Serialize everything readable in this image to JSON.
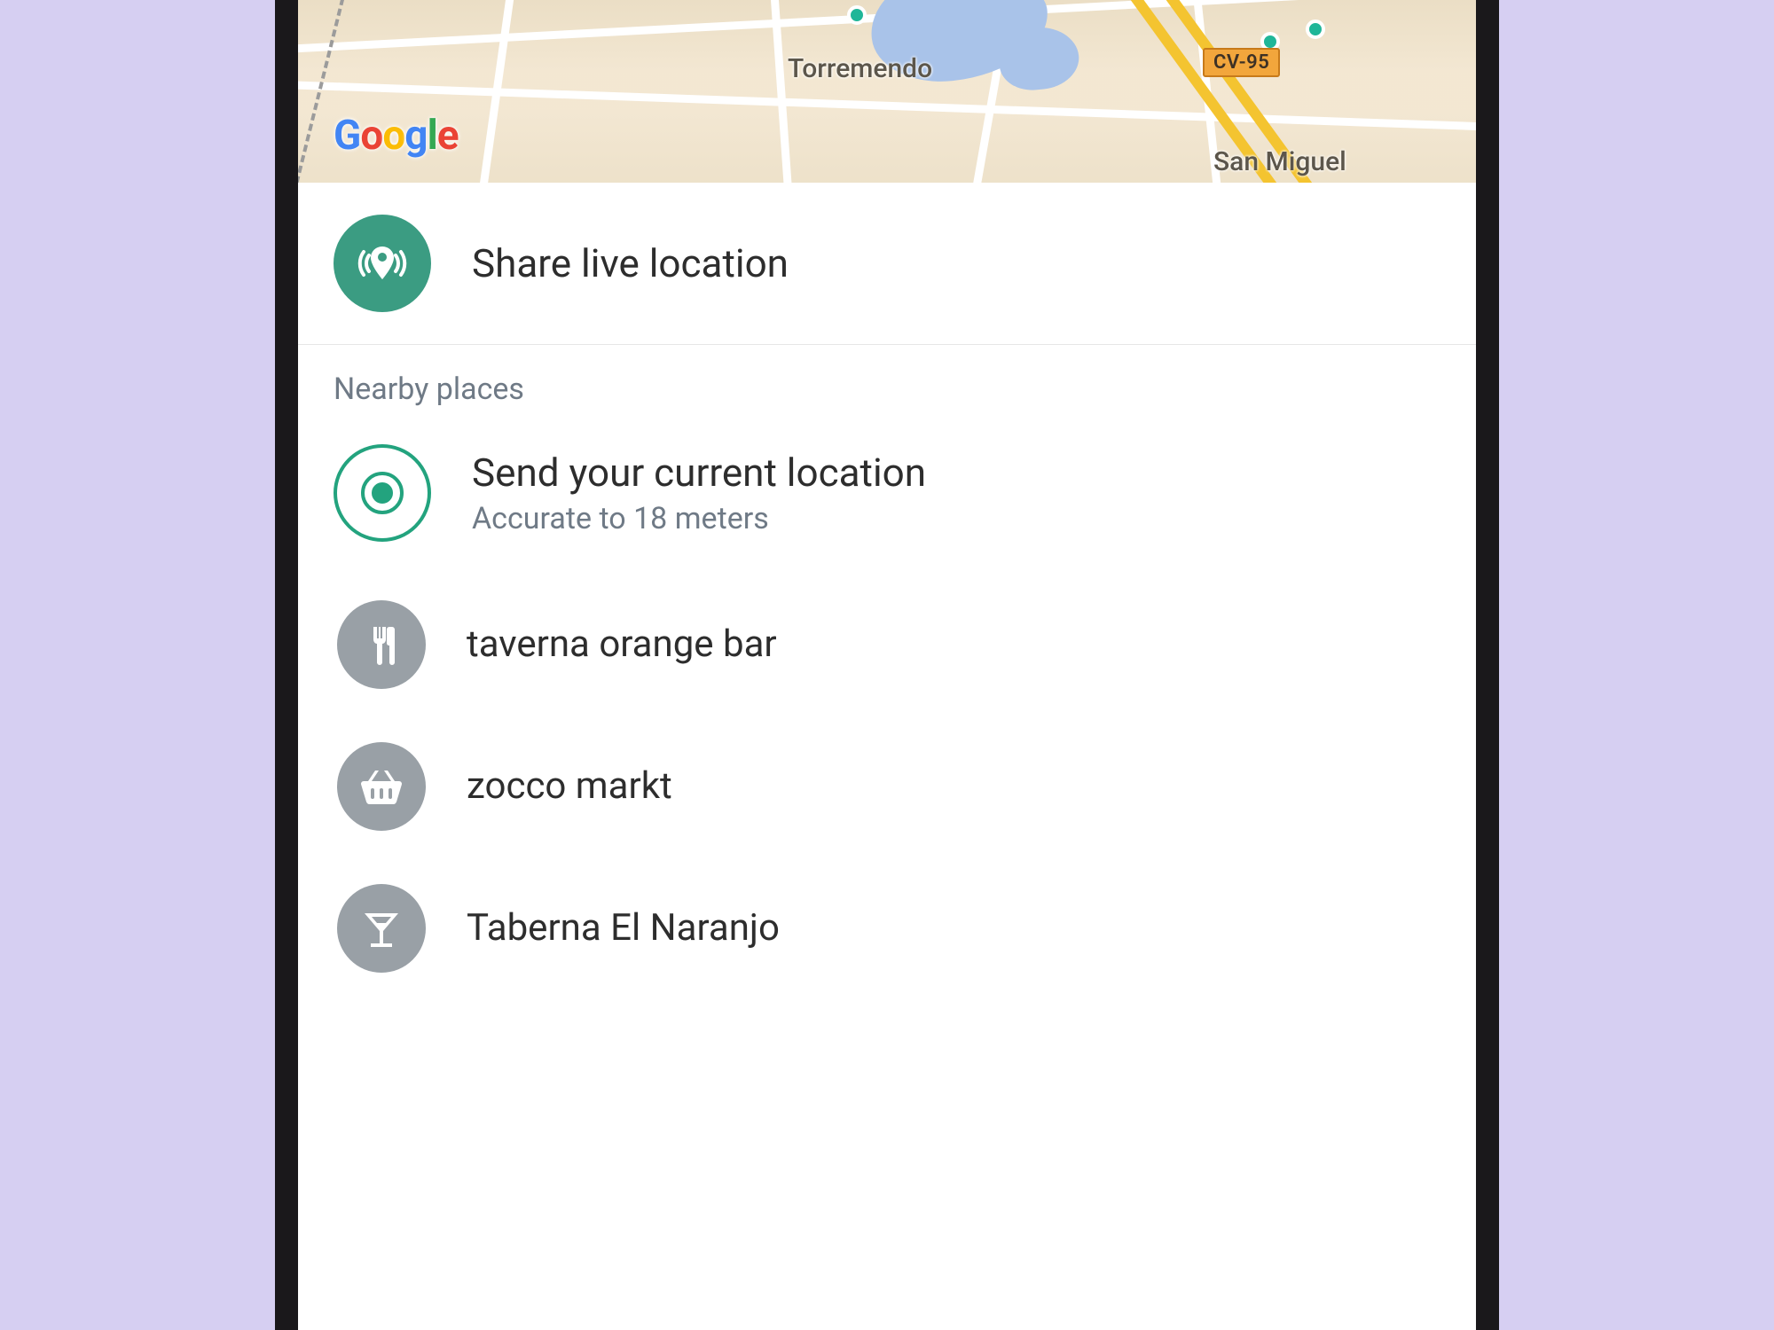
{
  "map": {
    "attribution_logo": "Google",
    "labels": {
      "torremendo": "Torremendo",
      "san_miguel": "San Miguel"
    },
    "road_shield": "CV-95"
  },
  "share_live": {
    "label": "Share live location"
  },
  "section": {
    "nearby_header": "Nearby places"
  },
  "current_location": {
    "title": "Send your current location",
    "subtitle": "Accurate to 18 meters"
  },
  "places": [
    {
      "name": "taverna orange bar",
      "icon": "restaurant"
    },
    {
      "name": "zocco markt",
      "icon": "shopping"
    },
    {
      "name": "Taberna El Naranjo",
      "icon": "bar"
    }
  ],
  "colors": {
    "accent_green": "#3b9c82",
    "outline_green": "#23a37e",
    "icon_grey": "#99a0a6"
  }
}
